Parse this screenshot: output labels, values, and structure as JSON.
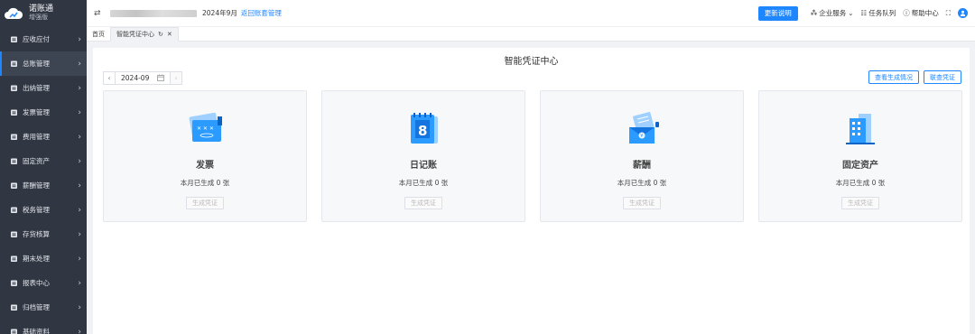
{
  "app": {
    "name": "诺账通",
    "edition": "增强版"
  },
  "sidebar": {
    "items": [
      {
        "label": "应收应付",
        "icon": "receivable-icon",
        "active": false
      },
      {
        "label": "总账管理",
        "icon": "ledger-icon",
        "active": true
      },
      {
        "label": "出纳管理",
        "icon": "cashier-icon",
        "active": false
      },
      {
        "label": "发票管理",
        "icon": "invoice-icon",
        "active": false
      },
      {
        "label": "费用管理",
        "icon": "expense-icon",
        "active": false
      },
      {
        "label": "固定资产",
        "icon": "asset-icon",
        "active": false
      },
      {
        "label": "薪酬管理",
        "icon": "salary-icon",
        "active": false
      },
      {
        "label": "税务管理",
        "icon": "tax-icon",
        "active": false
      },
      {
        "label": "存货核算",
        "icon": "inventory-icon",
        "active": false
      },
      {
        "label": "期末处理",
        "icon": "period-end-icon",
        "active": false
      },
      {
        "label": "报表中心",
        "icon": "report-icon",
        "active": false
      },
      {
        "label": "归档管理",
        "icon": "archive-icon",
        "active": false
      },
      {
        "label": "基础资料",
        "icon": "basic-data-icon",
        "active": false
      }
    ]
  },
  "topbar": {
    "period": "2024年9月",
    "back_link": "返回账套管理",
    "update_button": "更新说明",
    "enterprise_service": "企业服务",
    "task_queue": "任务队列",
    "help_center": "帮助中心"
  },
  "tabs": [
    {
      "label": "首页",
      "active": false
    },
    {
      "label": "智能凭证中心",
      "active": true
    }
  ],
  "main": {
    "title": "智能凭证中心",
    "date_value": "2024-09",
    "btn_view_status": "查看生成情况",
    "btn_link_voucher": "联查凭证",
    "cards": [
      {
        "title": "发票",
        "count_text": "本月已生成 0 张",
        "button": "生成凭证",
        "icon": "invoice-card-icon"
      },
      {
        "title": "日记账",
        "count_text": "本月已生成 0 张",
        "button": "生成凭证",
        "icon": "journal-card-icon"
      },
      {
        "title": "薪酬",
        "count_text": "本月已生成 0 张",
        "button": "生成凭证",
        "icon": "salary-card-icon"
      },
      {
        "title": "固定资产",
        "count_text": "本月已生成 0 张",
        "button": "生成凭证",
        "icon": "fixed-asset-card-icon"
      }
    ]
  },
  "colors": {
    "accent": "#1e87ff",
    "sidebar_bg": "#303642",
    "card_bg": "#f7f8fa"
  }
}
